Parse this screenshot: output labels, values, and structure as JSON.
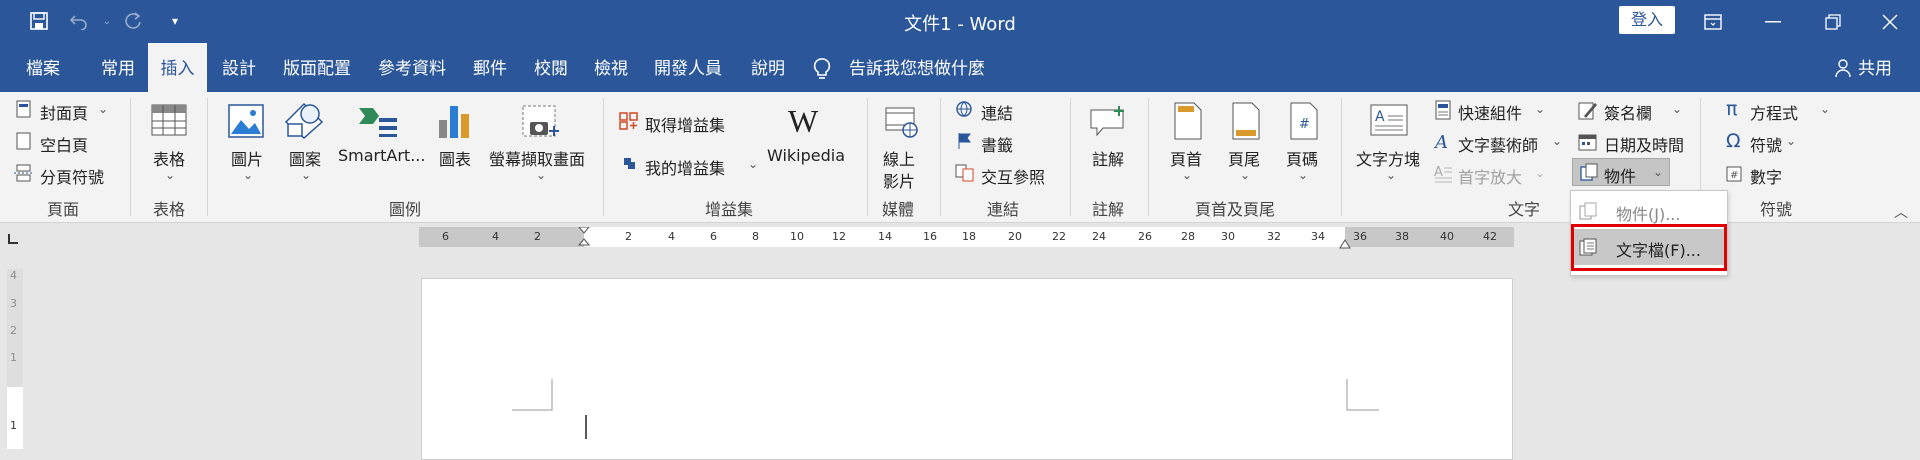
{
  "title": "文件1 - Word",
  "login_label": "登入",
  "share_label": "共用",
  "tell_me": "告訴我您想做什麼",
  "tabs": [
    "檔案",
    "常用",
    "插入",
    "設計",
    "版面配置",
    "參考資料",
    "郵件",
    "校閱",
    "檢視",
    "開發人員",
    "說明"
  ],
  "groups": {
    "pages": {
      "name": "頁面",
      "items": [
        "封面頁",
        "空白頁",
        "分頁符號"
      ]
    },
    "tables": {
      "name": "表格",
      "items": [
        "表格"
      ]
    },
    "illustrations": {
      "name": "圖例",
      "items": [
        "圖片",
        "圖案",
        "SmartArt...",
        "圖表",
        "螢幕擷取畫面"
      ]
    },
    "addins": {
      "name": "增益集",
      "items": [
        "取得增益集",
        "我的增益集",
        "Wikipedia"
      ]
    },
    "media": {
      "name": "媒體",
      "items": [
        "線上\n影片"
      ]
    },
    "links": {
      "name": "連結",
      "items": [
        "連結",
        "書籤",
        "交互參照"
      ]
    },
    "comments": {
      "name": "註解",
      "items": [
        "註解"
      ]
    },
    "header_footer": {
      "name": "頁首及頁尾",
      "items": [
        "頁首",
        "頁尾",
        "頁碼"
      ]
    },
    "text": {
      "name": "文字",
      "items": [
        "文字方塊",
        "快速組件",
        "文字藝術師",
        "首字放大",
        "簽名欄",
        "日期及時間",
        "物件"
      ]
    },
    "symbols": {
      "name": "符號",
      "items": [
        "方程式",
        "符號",
        "數字"
      ]
    }
  },
  "media_line1": "線上",
  "media_line2": "影片",
  "dropdown": {
    "items": [
      "物件(J)...",
      "文字檔(F)..."
    ]
  },
  "ruler_ticks": [
    "6",
    "4",
    "2",
    "2",
    "4",
    "6",
    "8",
    "10",
    "12",
    "14",
    "16",
    "18",
    "20",
    "22",
    "24",
    "26",
    "28",
    "30",
    "32",
    "34",
    "36",
    "38",
    "40",
    "42"
  ],
  "vruler_ticks": [
    "4",
    "3",
    "2",
    "1",
    "1"
  ]
}
